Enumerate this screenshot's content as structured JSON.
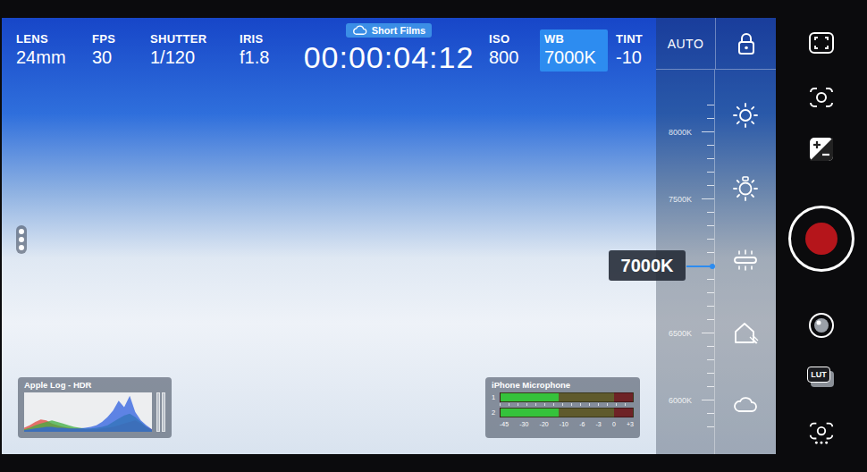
{
  "top_bar": {
    "left": [
      {
        "label": "LENS",
        "value": "24mm",
        "selected": false
      },
      {
        "label": "FPS",
        "value": "30",
        "selected": false
      },
      {
        "label": "SHUTTER",
        "value": "1/120",
        "selected": false
      },
      {
        "label": "IRIS",
        "value": "f1.8",
        "selected": false
      }
    ],
    "project": "Short Films",
    "timecode": "00:00:04:12",
    "right": [
      {
        "label": "ISO",
        "value": "800",
        "selected": false
      },
      {
        "label": "WB",
        "value": "7000K",
        "selected": true
      },
      {
        "label": "TINT",
        "value": "-10",
        "selected": false
      }
    ]
  },
  "white_balance": {
    "mode": "AUTO",
    "scale": [
      {
        "kind": "tick",
        "label": "8000K"
      },
      {
        "kind": "tick",
        "label": "7500K"
      },
      {
        "kind": "current",
        "label": "7000K"
      },
      {
        "kind": "tick",
        "label": "6500K"
      },
      {
        "kind": "tick",
        "label": "6000K"
      }
    ]
  },
  "histogram": {
    "title": "Apple Log - HDR",
    "series": [
      {
        "color": "#e0463c",
        "values": [
          5,
          8,
          12,
          15,
          14,
          10,
          8,
          6,
          5,
          4,
          4,
          3,
          3,
          3,
          4,
          5,
          6,
          8,
          10,
          12,
          14,
          10,
          6,
          3
        ]
      },
      {
        "color": "#3fae3f",
        "values": [
          3,
          5,
          8,
          10,
          12,
          14,
          12,
          10,
          8,
          6,
          5,
          4,
          4,
          5,
          6,
          8,
          12,
          16,
          20,
          22,
          18,
          12,
          6,
          2
        ]
      },
      {
        "color": "#2d5fe0",
        "values": [
          2,
          3,
          4,
          5,
          6,
          6,
          5,
          5,
          4,
          4,
          4,
          5,
          6,
          8,
          12,
          18,
          26,
          38,
          30,
          44,
          24,
          14,
          8,
          3
        ]
      }
    ]
  },
  "audio": {
    "title": "iPhone Microphone",
    "channels": [
      {
        "name": "1",
        "level": 0.44
      },
      {
        "name": "2",
        "level": 0.44
      }
    ],
    "scale": [
      "-45",
      "-30",
      "-20",
      "-10",
      "-6",
      "-3",
      "0",
      "+3"
    ]
  },
  "controls": {
    "lut": "LUT"
  }
}
